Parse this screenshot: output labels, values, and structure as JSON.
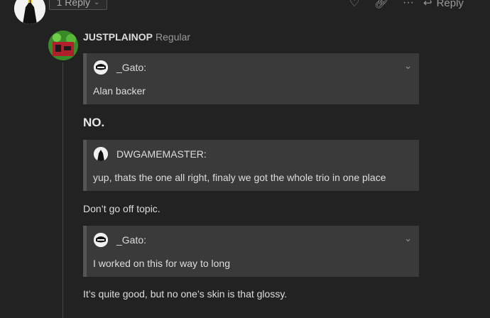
{
  "previous_post": {
    "avatar_icon": "black-figure-avatar",
    "replies_label": "1 Reply",
    "like_icon": "heart-icon",
    "link_icon": "link-icon",
    "more_icon": "ellipsis-icon",
    "reply_label": "Reply"
  },
  "post": {
    "username": "JUSTPLAINOP",
    "user_title": "Regular",
    "heading": "NO.",
    "quotes": [
      {
        "author": "_Gato:",
        "text": "Alan backer",
        "expandable": true
      },
      {
        "author": "DWGAMEMASTER:",
        "text": "yup, thats the one all right, finaly we got the whole trio in one place",
        "expandable": false
      },
      {
        "author": "_Gato:",
        "text": "I worked on this for way to long",
        "expandable": true
      }
    ],
    "paragraphs": [
      "Don’t go off topic.",
      "It’s quite good, but no one’s skin is that glossy."
    ]
  },
  "colors": {
    "background": "#222222",
    "quote_bg": "#3a3a3a",
    "quote_border": "#555555",
    "text": "#dddddd",
    "muted": "#999999"
  }
}
